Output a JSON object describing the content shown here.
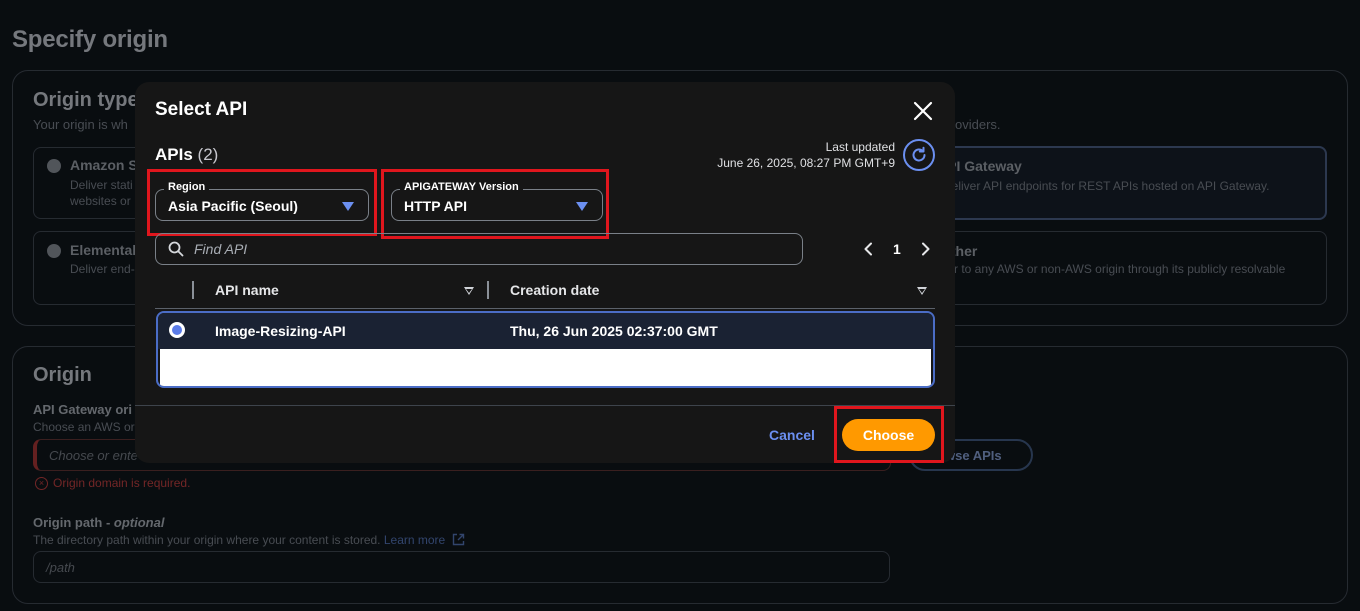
{
  "background": {
    "page_title": "Specify origin",
    "origin_type": {
      "heading": "Origin type",
      "subtitle": "Your origin is wh",
      "subtitle_right": "oviders.",
      "cards": [
        {
          "title": "Amazon S3",
          "desc_line1": "Deliver stati",
          "desc_line2": "websites or"
        },
        {
          "title": "API Gateway",
          "desc_line1": "Deliver API endpoints for REST APIs hosted on API Gateway.",
          "desc_line2": ""
        },
        {
          "title": "Elemental",
          "desc_line1": "Deliver end-",
          "desc_line2": ""
        },
        {
          "title": "Other",
          "desc_line1": "fer to any AWS or non-AWS origin through its publicly resolvable",
          "desc_line2": "L."
        }
      ]
    },
    "origin": {
      "heading": "Origin",
      "gw_label": "API Gateway ori",
      "gw_desc": "Choose an AWS ori",
      "gw_placeholder": "Choose or ente",
      "gw_error": "Origin domain is required.",
      "browse_label": "wse APIs",
      "path_label": "Origin path - ",
      "path_label_optional": "optional",
      "path_desc": "The directory path within your origin where your content is stored.",
      "learn_more": "Learn more",
      "path_placeholder": "/path"
    }
  },
  "modal": {
    "title": "Select API",
    "apis_label": "APIs",
    "apis_count": "(2)",
    "last_updated_label": "Last updated",
    "last_updated_value": "June 26, 2025, 08:27 PM GMT+9",
    "region": {
      "label": "Region",
      "value": "Asia Pacific (Seoul)"
    },
    "version": {
      "label": "APIGATEWAY Version",
      "value": "HTTP API"
    },
    "search": {
      "placeholder": "Find API",
      "value": ""
    },
    "pagination": {
      "current_page": "1"
    },
    "table": {
      "columns": [
        "API name",
        "Creation date"
      ],
      "rows": [
        {
          "name": "Image-Resizing-API",
          "created": "Thu, 26 Jun 2025 02:37:00 GMT",
          "selected": true
        }
      ]
    },
    "cancel_label": "Cancel",
    "choose_label": "Choose"
  },
  "colors": {
    "accent_blue": "#6b8ff0",
    "primary_orange": "#ff9900",
    "highlight_red": "#e0161d"
  }
}
